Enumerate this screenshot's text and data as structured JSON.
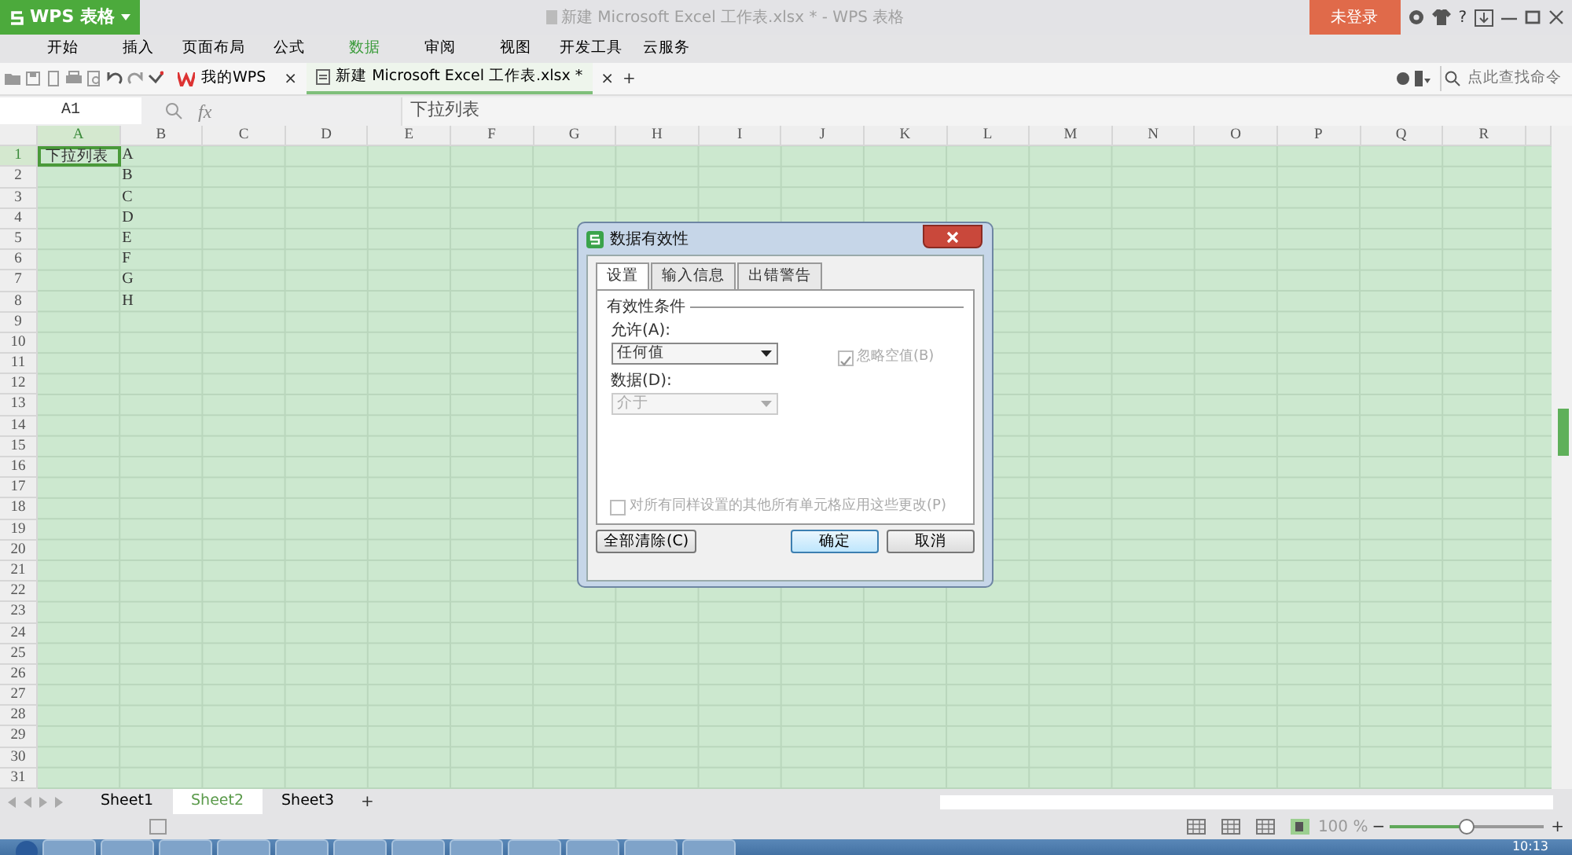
{
  "title_bar": {
    "app_button": "WPS 表格",
    "title": "新建 Microsoft Excel 工作表.xlsx * - WPS 表格",
    "login_button": "未登录",
    "help": "?"
  },
  "menu": [
    {
      "label": "开始",
      "selected": false
    },
    {
      "label": "插入",
      "selected": false
    },
    {
      "label": "页面布局",
      "selected": false
    },
    {
      "label": "公式",
      "selected": false
    },
    {
      "label": "数据",
      "selected": true
    },
    {
      "label": "审阅",
      "selected": false
    },
    {
      "label": "视图",
      "selected": false
    },
    {
      "label": "开发工具",
      "selected": false
    },
    {
      "label": "云服务",
      "selected": false
    }
  ],
  "doc_tabs": [
    {
      "label": "我的WPS",
      "close": "×",
      "selected": false
    },
    {
      "label": "新建 Microsoft Excel 工作表.xlsx *",
      "close": "×",
      "selected": true
    }
  ],
  "new_tab": "+",
  "command_search": {
    "placeholder": "点此查找命令"
  },
  "formula_bar": {
    "cell_ref": "A1",
    "fx": "fx",
    "content": "下拉列表"
  },
  "columns": [
    {
      "label": "A",
      "selected": true
    },
    {
      "label": "B",
      "selected": false
    },
    {
      "label": "C",
      "selected": false
    },
    {
      "label": "D",
      "selected": false
    },
    {
      "label": "E",
      "selected": false
    },
    {
      "label": "F",
      "selected": false
    },
    {
      "label": "G",
      "selected": false
    },
    {
      "label": "H",
      "selected": false
    },
    {
      "label": "I",
      "selected": false
    },
    {
      "label": "J",
      "selected": false
    },
    {
      "label": "K",
      "selected": false
    },
    {
      "label": "L",
      "selected": false
    },
    {
      "label": "M",
      "selected": false
    },
    {
      "label": "N",
      "selected": false
    },
    {
      "label": "O",
      "selected": false
    },
    {
      "label": "P",
      "selected": false
    },
    {
      "label": "Q",
      "selected": false
    },
    {
      "label": "R",
      "selected": false
    }
  ],
  "rows": [
    {
      "header": "1",
      "selected": true,
      "col_1": "下拉列表",
      "col_2": "A"
    },
    {
      "header": "2",
      "selected": false,
      "col_2": "B"
    },
    {
      "header": "3",
      "selected": false,
      "col_2": "C"
    },
    {
      "header": "4",
      "selected": false,
      "col_2": "D"
    },
    {
      "header": "5",
      "selected": false,
      "col_2": "E"
    },
    {
      "header": "6",
      "selected": false,
      "col_2": "F"
    },
    {
      "header": "7",
      "selected": false,
      "col_2": "G"
    },
    {
      "header": "8",
      "selected": false,
      "col_2": "H"
    },
    {
      "header": "9",
      "selected": false
    },
    {
      "header": "10",
      "selected": false
    },
    {
      "header": "11",
      "selected": false
    },
    {
      "header": "12",
      "selected": false
    },
    {
      "header": "13",
      "selected": false
    },
    {
      "header": "14",
      "selected": false
    },
    {
      "header": "15",
      "selected": false
    },
    {
      "header": "16",
      "selected": false
    },
    {
      "header": "17",
      "selected": false
    },
    {
      "header": "18",
      "selected": false
    },
    {
      "header": "19",
      "selected": false
    },
    {
      "header": "20",
      "selected": false
    },
    {
      "header": "21",
      "selected": false
    },
    {
      "header": "22",
      "selected": false
    },
    {
      "header": "23",
      "selected": false
    },
    {
      "header": "24",
      "selected": false
    },
    {
      "header": "25",
      "selected": false
    },
    {
      "header": "26",
      "selected": false
    },
    {
      "header": "27",
      "selected": false
    },
    {
      "header": "28",
      "selected": false
    },
    {
      "header": "29",
      "selected": false
    },
    {
      "header": "30",
      "selected": false
    },
    {
      "header": "31",
      "selected": false
    }
  ],
  "sheet_tabs": [
    {
      "label": "Sheet1",
      "selected": false
    },
    {
      "label": "Sheet2",
      "selected": true
    },
    {
      "label": "Sheet3",
      "selected": false
    }
  ],
  "add_sheet": "+",
  "status_bar": {
    "zoom": "100 %",
    "zoom_out": "−",
    "zoom_in": "+",
    "zoom_slider": {
      "level": 0.5
    }
  },
  "taskbar": {
    "clock": "10:13"
  },
  "dialog": {
    "title": "数据有效性",
    "tabs": [
      {
        "label": "设置",
        "selected": true
      },
      {
        "label": "输入信息",
        "selected": false
      },
      {
        "label": "出错警告",
        "selected": false
      }
    ],
    "section": "有效性条件",
    "allow_label": "允许(A):",
    "allow": {
      "value": "任何值",
      "disabled": false
    },
    "ignore_blank": {
      "label": "忽略空值(B)",
      "checked": true,
      "disabled": true
    },
    "data_label": "数据(D):",
    "data": {
      "value": "介于",
      "disabled": true
    },
    "apply_all": {
      "label": "对所有同样设置的其他所有单元格应用这些更改(P)",
      "checked": false,
      "disabled": true
    },
    "clear_button": "全部清除(C)",
    "ok_button": "确定",
    "cancel_button": "取消"
  }
}
